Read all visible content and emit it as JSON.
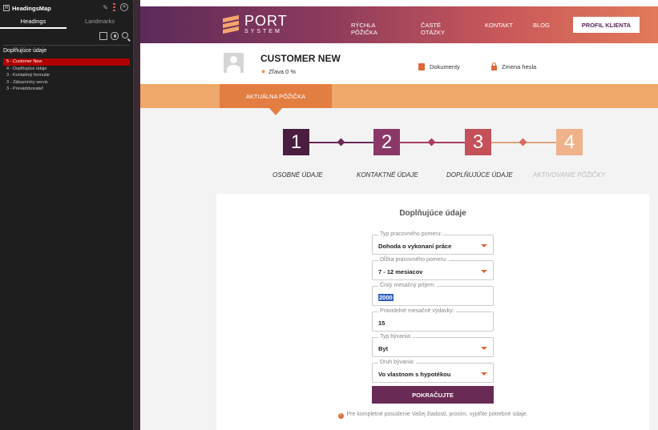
{
  "sidebar": {
    "title": "HeadingsMap",
    "tabs": [
      "Headings",
      "Landmarks"
    ],
    "section_title": "Doplňujúce údaje",
    "items": [
      "5 - Customer New",
      "4 - Doplňujúce údaje",
      "3 - Kontaktný formulár",
      "3 - Zákaznícky servis",
      "3 - Prevádzkovateľ"
    ],
    "icons": [
      "pin-icon",
      "menu-icon",
      "close-icon",
      "document-icon",
      "eye-icon",
      "search-icon"
    ]
  },
  "header": {
    "brand_name": "PORT",
    "brand_sub": "SYSTEM",
    "nav": [
      "RÝCHLA PÔŽIČKA",
      "ČASTÉ OTÁZKY",
      "KONTAKT",
      "BLOG"
    ],
    "profile_button": "PROFIL KLIENTA"
  },
  "user": {
    "name": "CUSTOMER NEW",
    "discount": "Zľava 0 %",
    "links": [
      "Dokumenty",
      "Zmena hesla"
    ]
  },
  "tab": {
    "active": "AKTUÁLNA PÔŽIČKA"
  },
  "steps": [
    {
      "number": "1",
      "label": "OSOBNÉ ÚDAJE"
    },
    {
      "number": "2",
      "label": "KONTAKTNÉ ÚDAJE"
    },
    {
      "number": "3",
      "label": "DOPLŇUJÚCE ÚDAJE"
    },
    {
      "number": "4",
      "label": "AKTIVOVANIE PÔŽIČKY"
    }
  ],
  "form": {
    "title": "Doplňujúce údaje",
    "fields": [
      {
        "label": "Typ pracovného pomeru:",
        "value": "Dohoda o vykonaní práce"
      },
      {
        "label": "Dĺžka pracovného pomeru:",
        "value": "7 - 12 mesiacov"
      },
      {
        "label": "Čistý mesačný príjem:",
        "value": "2000"
      },
      {
        "label": "Pravidelné mesačné výdavky:",
        "value": "15"
      },
      {
        "label": "Typ bývania:",
        "value": "Byt"
      },
      {
        "label": "Druh bývania:",
        "value": "Vo vlastnom s hypotékou"
      }
    ],
    "submit": "POKRAČUJTE",
    "note": "Pre kompletné posúdenie Vašej žiadosti, prosím, vyplňte potrebné údaje."
  },
  "colors": {
    "accent_dark": "#6a2a56",
    "accent_orange": "#e37e42",
    "tab_bar": "#f0a86c",
    "active_heading": "#b00000"
  }
}
